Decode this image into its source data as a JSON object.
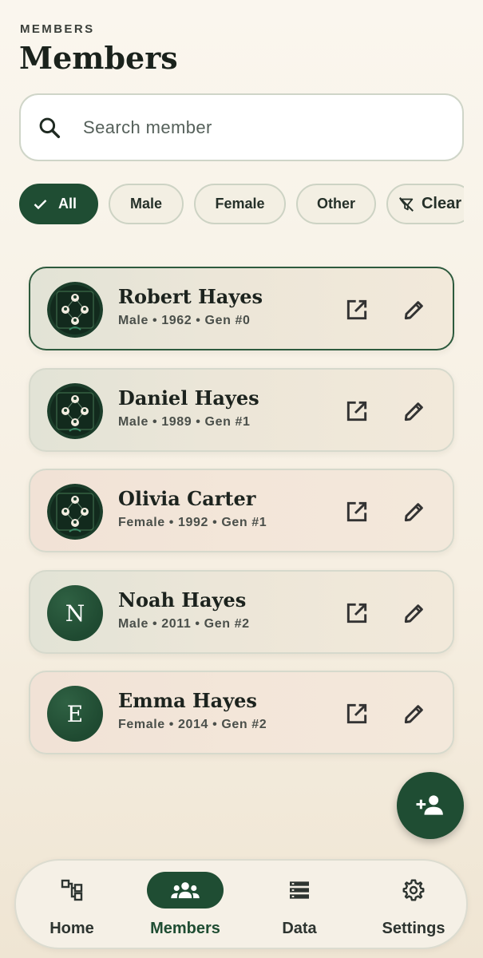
{
  "header": {
    "eyebrow": "MEMBERS",
    "title": "Members"
  },
  "search": {
    "placeholder": "Search member"
  },
  "filters": [
    {
      "label": "All",
      "selected": true
    },
    {
      "label": "Male",
      "selected": false
    },
    {
      "label": "Female",
      "selected": false
    },
    {
      "label": "Other",
      "selected": false
    },
    {
      "label": "Clear",
      "selected": false
    }
  ],
  "members": [
    {
      "name": "Robert Hayes",
      "meta": "Male • 1962 • Gen #0",
      "avatar": "tree-image",
      "highlighted": true
    },
    {
      "name": "Daniel Hayes",
      "meta": "Male • 1989 • Gen #1",
      "avatar": "tree-image"
    },
    {
      "name": "Olivia Carter",
      "meta": "Female • 1992 • Gen #1",
      "avatar": "tree-image"
    },
    {
      "name": "Noah Hayes",
      "meta": "Male • 2011 • Gen #2",
      "avatar": "N"
    },
    {
      "name": "Emma Hayes",
      "meta": "Female • 2014 • Gen #2",
      "avatar": "E"
    }
  ],
  "fab": {
    "icon": "add-person-icon"
  },
  "nav": [
    {
      "label": "Home",
      "icon": "tree-icon"
    },
    {
      "label": "Members",
      "icon": "group-icon",
      "active": true
    },
    {
      "label": "Data",
      "icon": "storage-icon"
    },
    {
      "label": "Settings",
      "icon": "gear-icon"
    }
  ],
  "colors": {
    "primary": "#1f4d33",
    "background": "#f7f1e6",
    "card_border_active": "#2d5a3d"
  }
}
